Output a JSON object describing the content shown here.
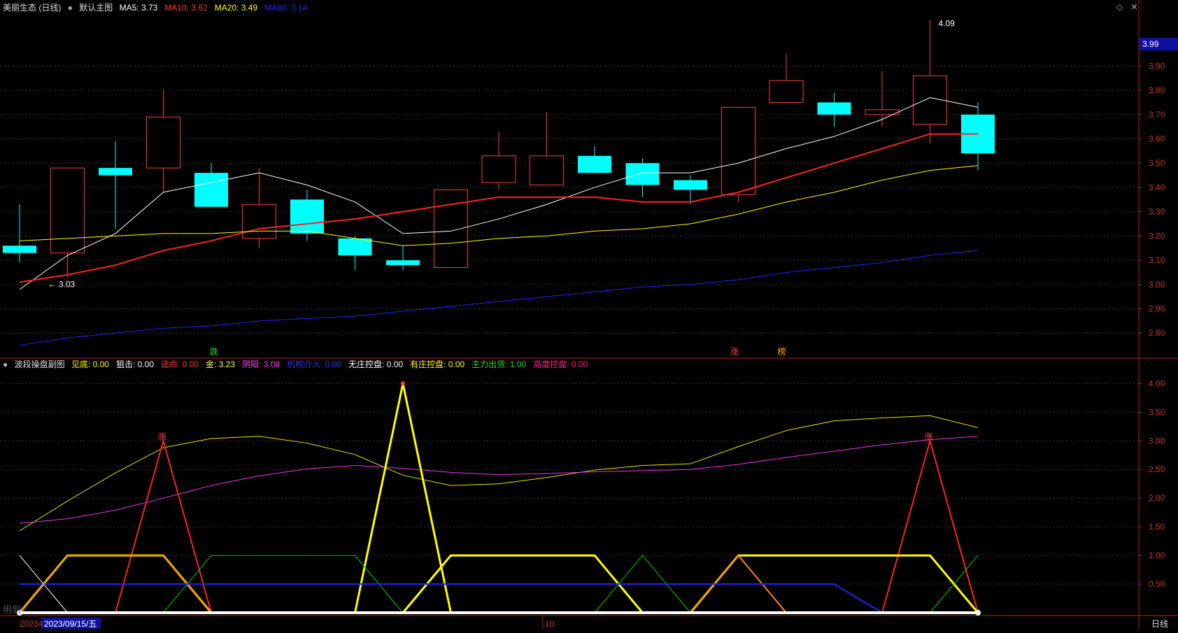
{
  "main_header": {
    "title": "美丽生态 (日线)",
    "chart_name": "默认主图",
    "indicators": [
      {
        "label": "MA5:",
        "value": "3.73",
        "color": "#ffffff"
      },
      {
        "label": "MA10:",
        "value": "3.62",
        "color": "#ff3333"
      },
      {
        "label": "MA20:",
        "value": "3.49",
        "color": "#ffff00"
      },
      {
        "label": "MA60:",
        "value": "3.14",
        "color": "#2222ff"
      }
    ]
  },
  "sub_header": {
    "chart_name": "波段操盘副图",
    "indicators": [
      {
        "label": "见底:",
        "value": "0.00",
        "color": "#ffff00"
      },
      {
        "label": "狙击:",
        "value": "0.00",
        "color": "#ffffff"
      },
      {
        "label": "逃命:",
        "value": "0.00",
        "color": "#ff3333"
      },
      {
        "label": "金:",
        "value": "3.23",
        "color": "#ffff66"
      },
      {
        "label": "阴阳:",
        "value": "3.08",
        "color": "#ff44ff"
      },
      {
        "label": "机构介入:",
        "value": "0.00",
        "color": "#3333ff"
      },
      {
        "label": "无庄控盘:",
        "value": "0.00",
        "color": "#ffffff"
      },
      {
        "label": "有庄控盘:",
        "value": "0.00",
        "color": "#ffff00"
      },
      {
        "label": "主力出货:",
        "value": "1.00",
        "color": "#22dd22"
      },
      {
        "label": "高度控盘:",
        "value": "0.00",
        "color": "#ff2288"
      }
    ]
  },
  "price_axis_labels": [
    "3.90",
    "3.80",
    "3.70",
    "3.60",
    "3.50",
    "3.40",
    "3.30",
    "3.20",
    "3.10",
    "3.00",
    "2.90",
    "2.80"
  ],
  "current_price_tag": "3.99",
  "sub_axis_labels": [
    "4.00",
    "3.50",
    "3.00",
    "2.50",
    "2.00",
    "1.50",
    "1.00",
    "0.50"
  ],
  "annotations": {
    "high_label": "4.09",
    "low_label": "3.03",
    "signal_down": "跌",
    "signal_up": "涨",
    "signal_bang": "榜",
    "sub_marker_1": "涨",
    "sub_marker_2": "涨"
  },
  "bottom_bar": {
    "date_start": "20234",
    "date_selected": "2023/09/15/五",
    "month_tick": "10",
    "period": "日线",
    "watermark": "用到"
  },
  "chart_data": [
    {
      "type": "candlestick",
      "title": "美丽生态 (日线)",
      "ylim": [
        2.72,
        4.12
      ],
      "candles": [
        {
          "o": 3.16,
          "h": 3.33,
          "l": 3.09,
          "c": 3.13
        },
        {
          "o": 3.13,
          "h": 3.48,
          "l": 3.03,
          "c": 3.48
        },
        {
          "o": 3.48,
          "h": 3.59,
          "l": 3.23,
          "c": 3.45
        },
        {
          "o": 3.48,
          "h": 3.8,
          "l": 3.38,
          "c": 3.69
        },
        {
          "o": 3.46,
          "h": 3.5,
          "l": 3.32,
          "c": 3.32
        },
        {
          "o": 3.19,
          "h": 3.48,
          "l": 3.15,
          "c": 3.33
        },
        {
          "o": 3.35,
          "h": 3.39,
          "l": 3.18,
          "c": 3.21
        },
        {
          "o": 3.19,
          "h": 3.2,
          "l": 3.06,
          "c": 3.12
        },
        {
          "o": 3.1,
          "h": 3.16,
          "l": 3.06,
          "c": 3.08
        },
        {
          "o": 3.07,
          "h": 3.39,
          "l": 3.07,
          "c": 3.39
        },
        {
          "o": 3.42,
          "h": 3.63,
          "l": 3.39,
          "c": 3.53
        },
        {
          "o": 3.41,
          "h": 3.71,
          "l": 3.41,
          "c": 3.53
        },
        {
          "o": 3.53,
          "h": 3.57,
          "l": 3.46,
          "c": 3.46
        },
        {
          "o": 3.5,
          "h": 3.52,
          "l": 3.36,
          "c": 3.41
        },
        {
          "o": 3.43,
          "h": 3.45,
          "l": 3.33,
          "c": 3.39
        },
        {
          "o": 3.37,
          "h": 3.73,
          "l": 3.34,
          "c": 3.73
        },
        {
          "o": 3.75,
          "h": 3.95,
          "l": 3.75,
          "c": 3.84
        },
        {
          "o": 3.75,
          "h": 3.79,
          "l": 3.65,
          "c": 3.7
        },
        {
          "o": 3.7,
          "h": 3.88,
          "l": 3.65,
          "c": 3.72
        },
        {
          "o": 3.66,
          "h": 4.09,
          "l": 3.58,
          "c": 3.86
        },
        {
          "o": 3.7,
          "h": 3.75,
          "l": 3.47,
          "c": 3.54
        }
      ],
      "series": [
        {
          "name": "MA5",
          "color": "#ffffff",
          "values": [
            2.98,
            3.12,
            3.21,
            3.38,
            3.42,
            3.46,
            3.41,
            3.34,
            3.21,
            3.22,
            3.27,
            3.33,
            3.4,
            3.46,
            3.46,
            3.5,
            3.56,
            3.61,
            3.68,
            3.77,
            3.73
          ]
        },
        {
          "name": "MA10",
          "color": "#ff2222",
          "values": [
            3.01,
            3.04,
            3.08,
            3.14,
            3.18,
            3.23,
            3.25,
            3.27,
            3.3,
            3.33,
            3.36,
            3.36,
            3.36,
            3.34,
            3.34,
            3.38,
            3.44,
            3.5,
            3.56,
            3.62,
            3.62
          ]
        },
        {
          "name": "MA20",
          "color": "#ffff00",
          "values": [
            3.18,
            3.19,
            3.2,
            3.21,
            3.21,
            3.22,
            3.22,
            3.19,
            3.16,
            3.17,
            3.19,
            3.2,
            3.22,
            3.23,
            3.25,
            3.29,
            3.34,
            3.38,
            3.43,
            3.47,
            3.49
          ]
        },
        {
          "name": "MA60",
          "color": "#2222ff",
          "values": [
            2.75,
            2.78,
            2.8,
            2.82,
            2.83,
            2.85,
            2.86,
            2.87,
            2.89,
            2.91,
            2.93,
            2.95,
            2.97,
            2.99,
            3.0,
            3.02,
            3.05,
            3.07,
            3.09,
            3.12,
            3.14
          ]
        }
      ]
    },
    {
      "type": "line",
      "title": "波段操盘副图",
      "ylim": [
        0,
        4.2
      ],
      "series": [
        {
          "name": "金",
          "color": "#e6e600",
          "width": 1,
          "values": [
            1.43,
            1.95,
            2.44,
            2.88,
            3.04,
            3.08,
            2.96,
            2.76,
            2.4,
            2.22,
            2.25,
            2.36,
            2.49,
            2.57,
            2.6,
            2.9,
            3.18,
            3.35,
            3.4,
            3.44,
            3.23
          ]
        },
        {
          "name": "阴阳",
          "color": "#ee33ee",
          "width": 1,
          "values": [
            1.56,
            1.64,
            1.79,
            2.0,
            2.22,
            2.39,
            2.51,
            2.57,
            2.52,
            2.45,
            2.41,
            2.43,
            2.46,
            2.48,
            2.5,
            2.59,
            2.71,
            2.82,
            2.93,
            3.02,
            3.08
          ]
        },
        {
          "name": "逃命",
          "color": "#ff2222",
          "width": 2,
          "values": [
            0,
            0,
            0,
            3.0,
            0,
            0,
            0,
            0,
            0,
            0,
            0,
            0,
            0,
            0,
            0,
            0,
            0,
            0,
            0,
            3.0,
            0
          ]
        },
        {
          "name": "见底",
          "color": "#ffff00",
          "width": 3,
          "values": [
            0,
            0,
            0,
            0,
            0,
            0,
            0,
            0,
            4.0,
            0,
            0,
            0,
            0,
            0,
            0,
            0,
            0,
            0,
            0,
            0,
            0
          ]
        },
        {
          "name": "有庄控盘",
          "color": "#ffff00",
          "width": 3,
          "values": [
            0,
            1,
            1,
            1,
            0,
            0,
            0,
            0,
            0,
            1,
            1,
            1,
            1,
            0,
            0,
            1,
            1,
            1,
            1,
            1,
            0
          ]
        },
        {
          "name": "高度控盘",
          "color": "#ff8800",
          "width": 2,
          "values": [
            0,
            1,
            1,
            1,
            0,
            0,
            0,
            0,
            0,
            0,
            0,
            0,
            0,
            0,
            0,
            1,
            0,
            0,
            0,
            0,
            0
          ]
        },
        {
          "name": "主力出货",
          "color": "#00cc00",
          "width": 1,
          "values": [
            0,
            0,
            0,
            0,
            1,
            1,
            1,
            1,
            0,
            0,
            0,
            0,
            0,
            1,
            0,
            0,
            0,
            0,
            0,
            0,
            1
          ]
        },
        {
          "name": "机构介入",
          "color": "#2222ff",
          "width": 2,
          "values": [
            0.5,
            0.5,
            0.5,
            0.5,
            0.5,
            0.5,
            0.5,
            0.5,
            0.5,
            0.5,
            0.5,
            0.5,
            0.5,
            0.5,
            0.5,
            0.5,
            0.5,
            0.5,
            0,
            0,
            0
          ]
        },
        {
          "name": "狙击",
          "color": "#ffffff",
          "width": 1,
          "values": [
            1,
            0,
            0,
            0,
            0,
            0,
            0,
            0,
            0,
            0,
            0,
            0,
            0,
            0,
            0,
            0,
            0,
            0,
            0,
            0,
            0
          ]
        },
        {
          "name": "无庄控盘",
          "color": "#ffffff",
          "width": 4,
          "values": [
            0,
            0,
            0,
            0,
            0,
            0,
            0,
            0,
            0,
            0,
            0,
            0,
            0,
            0,
            0,
            0,
            0,
            0,
            0,
            0,
            0
          ]
        }
      ]
    }
  ]
}
